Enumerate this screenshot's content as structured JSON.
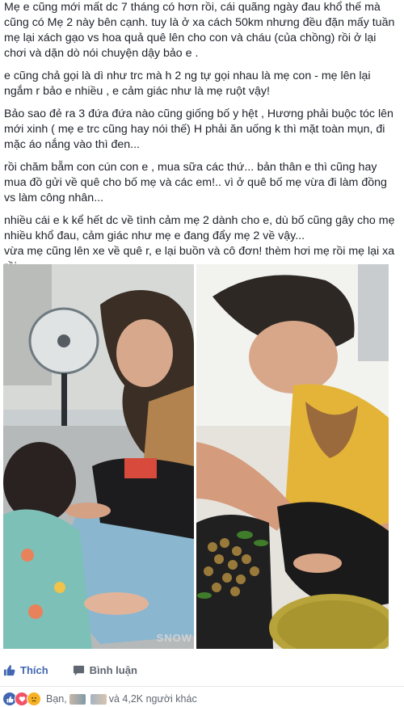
{
  "post": {
    "paragraphs": [
      "Mẹ e cũng mới mất dc 7 tháng có hơn rồi, cái quãng ngày đau khổ thế mà cũng có Mẹ 2 này bên cạnh. tuy là ở xa cách 50km nhưng đều đặn mấy tuần mẹ lại xách gạo vs hoa quả quê lên cho con và cháu (của chồng) rồi ở lại chơi và dặn dò nói chuyện dậy bảo e .",
      "e cũng chả gọi là dì như trc mà h 2 ng tự gọi nhau là mẹ con - mẹ lên lại ngắm r bảo e nhiều , e cảm giác như là mẹ ruột vậy!",
      "Bảo sao đẻ ra 3 đứa đứa nào cũng giống bố y hệt , Hương phải buộc tóc lên mới xinh ( mẹ e trc cũng hay nói thế) H phải ăn uống k thì mặt toàn mụn, đi mặc áo nắng vào thì đen...",
      "rồi chăm bẵm con cún con e , mua sữa các thứ... bản thân e thì cũng hay mua đồ gửi về quê cho bố mẹ và các em!.. vì ở quê bố mẹ vừa đi làm đồng vs làm công nhân...",
      "nhiều cái e k kể hết dc về tình cảm mẹ 2 dành cho e, dù bố cũng gây cho mẹ nhiều khổ đau, cảm giác như mẹ e đang đẩy mẹ 2 về vậy...",
      "vừa mẹ cũng lên xe về quê r, e lại buồn và cô đơn! thèm hơi mẹ rồi mẹ lại xa rồi ..."
    ]
  },
  "photos": {
    "watermark": "SNOW"
  },
  "actions": {
    "like_label": "Thích",
    "comment_label": "Bình luận"
  },
  "reactions": {
    "names_prefix": "Bạn,",
    "names_suffix": "và 4,2K người khác",
    "icons": [
      "like-icon",
      "love-icon",
      "sad-icon"
    ]
  },
  "colors": {
    "like_blue": "#4267b2",
    "love_red": "#f25268",
    "sad_yellow": "#f7b125",
    "text": "#1d2129",
    "secondary": "#606770"
  }
}
